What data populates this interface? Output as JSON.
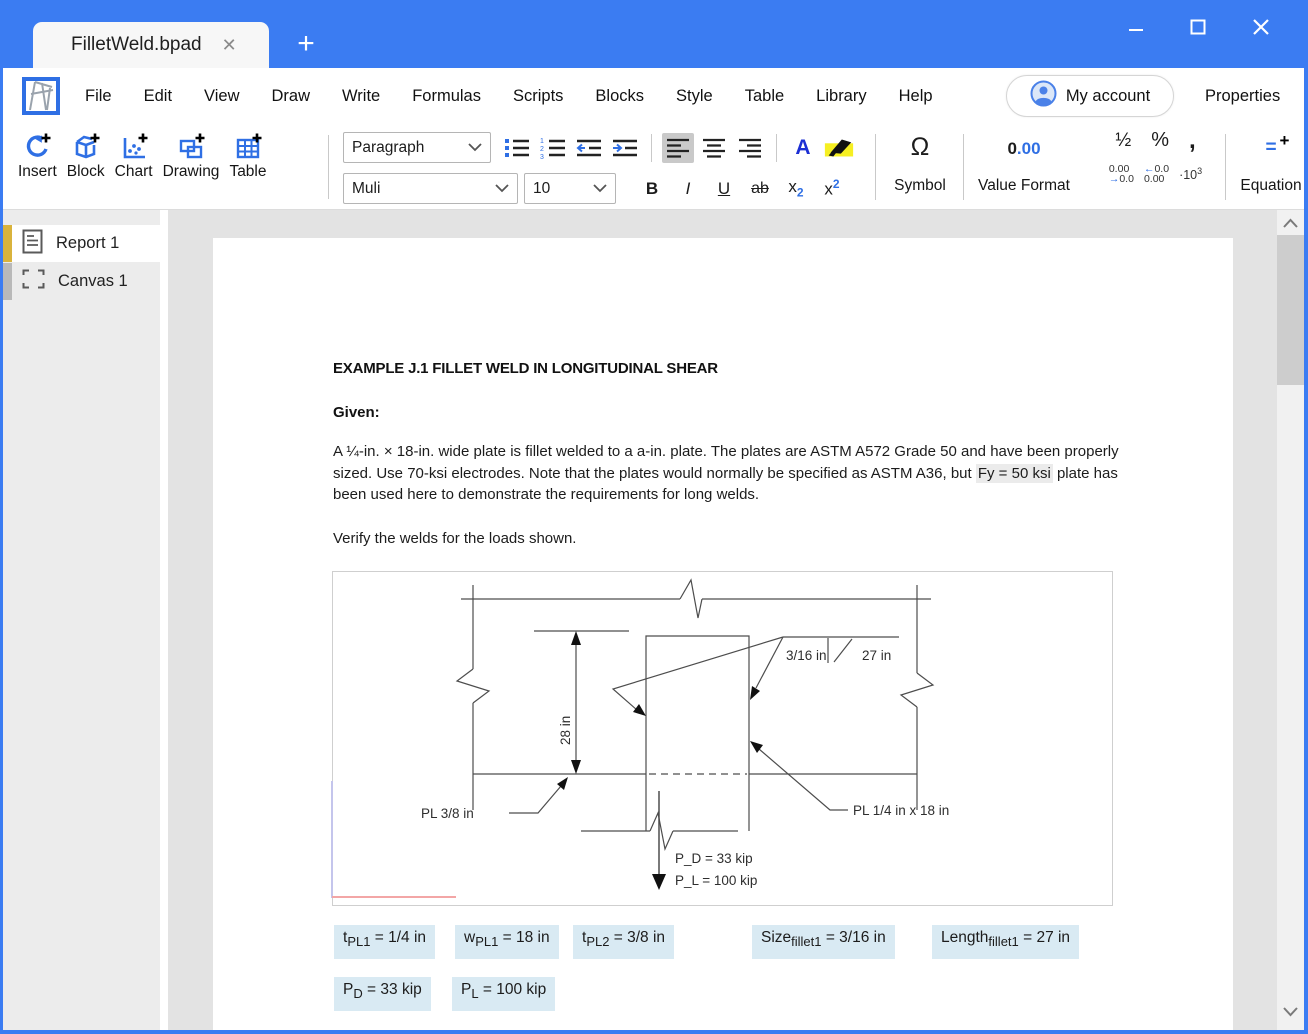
{
  "window": {
    "tab_title": "FilletWeld.bpad",
    "tab_close_icon": "✕",
    "new_tab_icon": "+",
    "minimize_icon": "–",
    "maximize_icon": "▢",
    "close_icon": "✕"
  },
  "menu": {
    "items": [
      "File",
      "Edit",
      "View",
      "Draw",
      "Write",
      "Formulas",
      "Scripts",
      "Blocks",
      "Style",
      "Table",
      "Library",
      "Help"
    ],
    "account_label": "My account",
    "properties_label": "Properties"
  },
  "toolbar": {
    "big": [
      {
        "label": "Insert"
      },
      {
        "label": "Block"
      },
      {
        "label": "Chart"
      },
      {
        "label": "Drawing"
      },
      {
        "label": "Table"
      }
    ],
    "paragraph_style": "Paragraph",
    "font_name": "Muli",
    "font_size": "10",
    "bold": "B",
    "italic": "I",
    "underline": "U",
    "strike": "ab",
    "subscript": {
      "base": "x",
      "n": "2"
    },
    "superscript": {
      "base": "x",
      "n": "2"
    },
    "font_color_glyph": "A",
    "symbol": {
      "glyph": "Ω",
      "label": "Symbol"
    },
    "value_format": {
      "zero": "0",
      "decimals": ".00",
      "label": "Value Format"
    },
    "misc": {
      "fraction": "½",
      "percent": "%",
      "comma": ","
    },
    "decimals": {
      "dec_top": "0.00",
      "dec_arrow": "→",
      "dec_bottom": "0.0",
      "inc_arrow": "←",
      "inc_top": "0.0",
      "inc_bottom": "0.00",
      "sci_base": "·10",
      "sci_exp": "3"
    },
    "equation": {
      "eq": "=",
      "plus": "+",
      "label": "Equation"
    }
  },
  "sidebar": {
    "items": [
      {
        "label": "Report 1"
      },
      {
        "label": "Canvas 1"
      }
    ]
  },
  "doc": {
    "heading": "EXAMPLE J.1 FILLET WELD IN LONGITUDINAL SHEAR",
    "given": "Given:",
    "para1": "A ¼-in. × 18-in. wide plate is fillet welded to a a-in. plate. The plates are ASTM A572 Grade 50 and have been properly sized. Use  70-ksi electrodes. Note that the plates would normally be specified as ASTM A36, but ",
    "para_field": "Fy = 50 ksi",
    "para2": " plate has been used here to demonstrate the requirements for long welds.",
    "verify": "Verify the welds for the loads shown."
  },
  "figure": {
    "weld_size": "3/16 in",
    "weld_length": "27 in",
    "height_dim": "28 in",
    "plate_left": "PL 3/8 in",
    "plate_right": "PL 1/4 in x 18 in",
    "load_dead": "P_D = 33 kip",
    "load_live": "P_L = 100 kip"
  },
  "fields": {
    "r1": [
      {
        "base": "t",
        "sub": "PL1",
        "rest": " = 1/4 in"
      },
      {
        "base": "w",
        "sub": "PL1",
        "rest": " = 18 in"
      },
      {
        "base": "t",
        "sub": "PL2",
        "rest": " = 3/8 in"
      },
      {
        "base": "Size",
        "sub": "fillet1",
        "rest": " = 3/16 in"
      },
      {
        "base": "Length",
        "sub": "fillet1",
        "rest": " = 27 in"
      }
    ],
    "r2": [
      {
        "base": "P",
        "sub": "D",
        "rest": " = 33 kip"
      },
      {
        "base": "P",
        "sub": "L",
        "rest": " = 100 kip"
      }
    ]
  },
  "colors": {
    "titlebar": "#3b7cf2",
    "accent": "#2f6fe4",
    "highlight": "#ffe812",
    "field_bg": "#d9eaf3",
    "inline_field_bg": "#ebebeb",
    "selected_gold": "#d9b33c"
  }
}
